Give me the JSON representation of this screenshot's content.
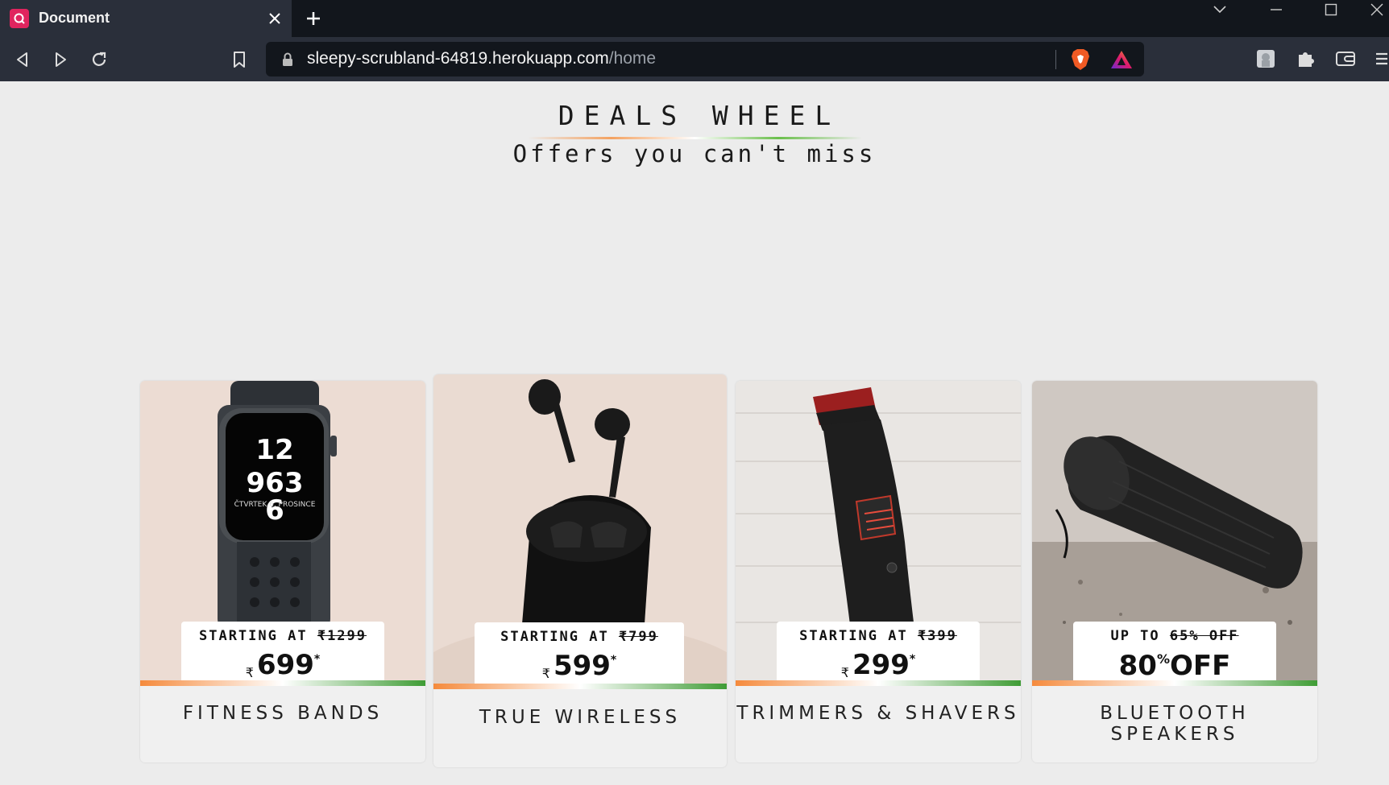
{
  "browser": {
    "tab_title": "Document",
    "url_domain": "sleepy-scrubland-64819.herokuapp.com",
    "url_path": "/home"
  },
  "page": {
    "title": "DEALS WHEEL",
    "subtitle": "Offers you can't miss"
  },
  "cards": [
    {
      "prefix": "STARTING AT",
      "old_price": "₹1299",
      "currency": "₹",
      "price": "699",
      "mark": "*",
      "label": "FITNESS BANDS"
    },
    {
      "prefix": "STARTING AT",
      "old_price": "₹799",
      "currency": "₹",
      "price": "599",
      "mark": "*",
      "label": "TRUE WIRELESS"
    },
    {
      "prefix": "STARTING AT",
      "old_price": "₹399",
      "currency": "₹",
      "price": "299",
      "mark": "*",
      "label": "TRIMMERS & SHAVERS"
    },
    {
      "prefix": "UP TO",
      "old_price": "65% OFF",
      "offer_value": "80",
      "offer_unit": "%",
      "offer_suffix": "OFF",
      "label": "BLUETOOTH SPEAKERS"
    }
  ],
  "colors": {
    "accent_orange": "#f58a3c",
    "accent_green": "#3f9c35",
    "tab_bg": "#2a2f3a",
    "chrome_bg": "#12161c"
  }
}
